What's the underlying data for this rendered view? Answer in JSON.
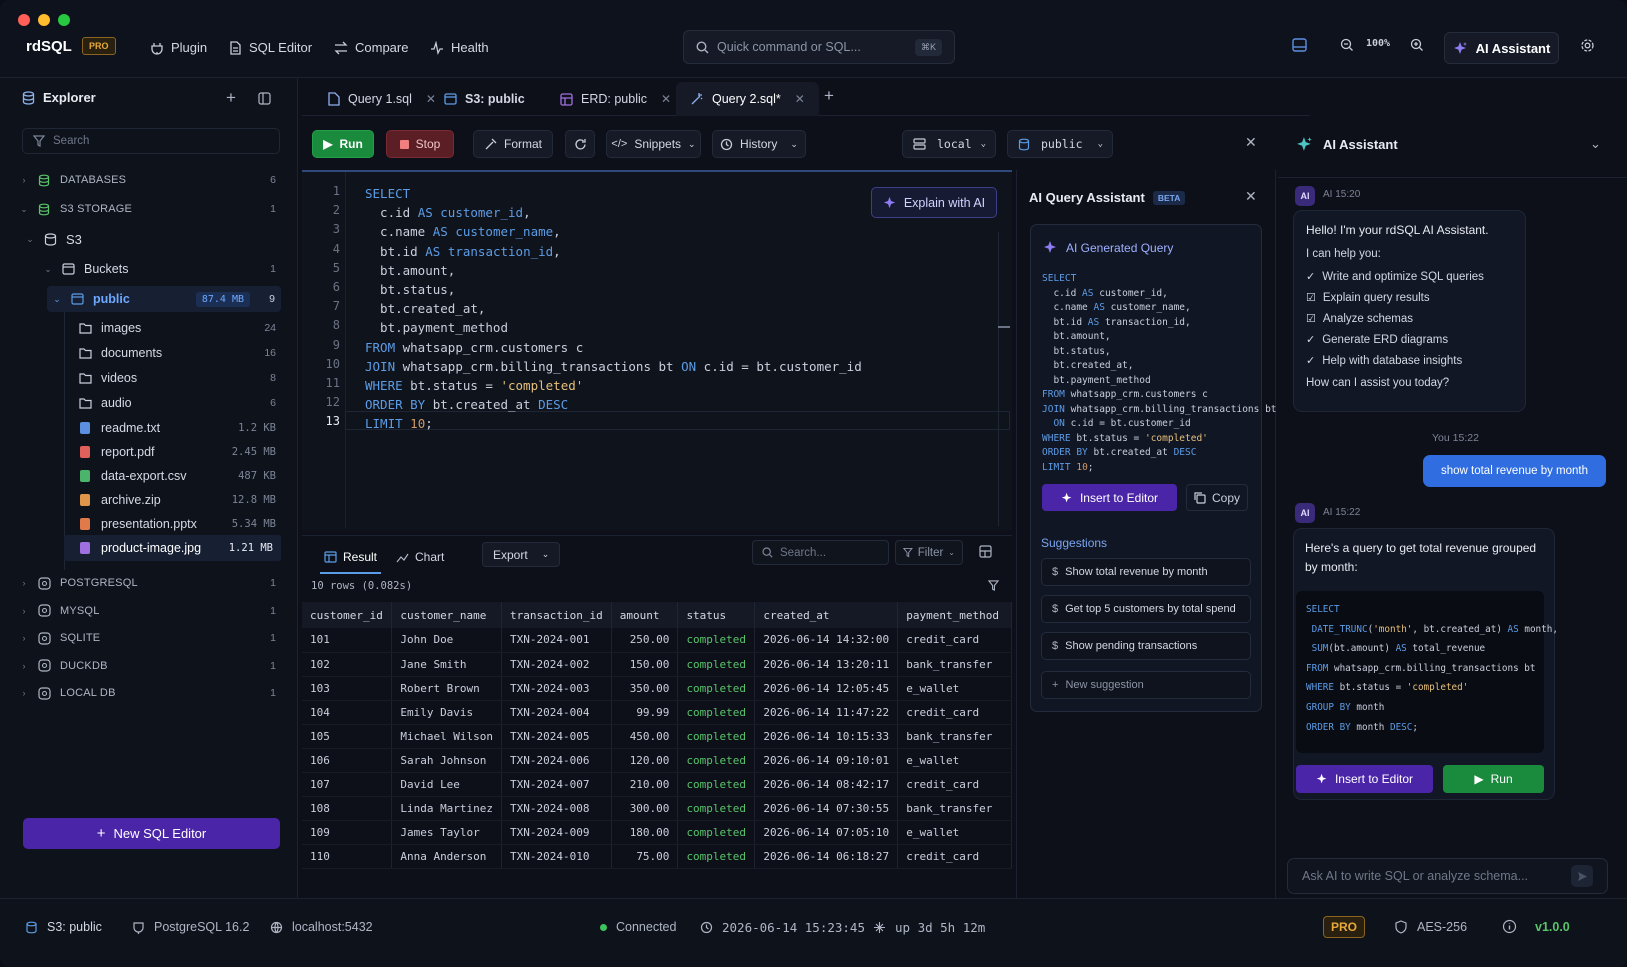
{
  "app": {
    "name": "rdSQL",
    "badge": "PRO"
  },
  "nav": [
    {
      "label": "Plugin",
      "icon": "plugin-icon"
    },
    {
      "label": "SQL Editor",
      "icon": "file-icon"
    },
    {
      "label": "Compare",
      "icon": "compare-icon"
    },
    {
      "label": "Health",
      "icon": "pulse-icon"
    }
  ],
  "quick_search": {
    "placeholder": "Quick command or SQL...",
    "shortcut": "⌘K"
  },
  "zoom": "100%",
  "ai_button": "AI Assistant",
  "explorer": {
    "title": "Explorer",
    "search_placeholder": "Search",
    "databases": {
      "label": "DATABASES",
      "count": "6"
    },
    "s3storage": {
      "label": "S3 STORAGE",
      "count": "1"
    },
    "s3": {
      "label": "S3"
    },
    "buckets": {
      "label": "Buckets",
      "count": "1"
    },
    "public": {
      "label": "public",
      "size": "87.4 MB",
      "count": "9"
    },
    "folders": [
      {
        "label": "images",
        "count": "24"
      },
      {
        "label": "documents",
        "count": "16"
      },
      {
        "label": "videos",
        "count": "8"
      },
      {
        "label": "audio",
        "count": "6"
      }
    ],
    "files": [
      {
        "label": "readme.txt",
        "size": "1.2 KB",
        "color": "#5c8fe0"
      },
      {
        "label": "report.pdf",
        "size": "2.45 MB",
        "color": "#e0605c"
      },
      {
        "label": "data-export.csv",
        "size": "487 KB",
        "color": "#4cb36a"
      },
      {
        "label": "archive.zip",
        "size": "12.8 MB",
        "color": "#e0964a"
      },
      {
        "label": "presentation.pptx",
        "size": "5.34 MB",
        "color": "#e07a4a"
      },
      {
        "label": "product-image.jpg",
        "size": "1.21 MB",
        "color": "#a070e0"
      }
    ],
    "engines": [
      {
        "label": "POSTGRESQL",
        "count": "1"
      },
      {
        "label": "MYSQL",
        "count": "1"
      },
      {
        "label": "SQLITE",
        "count": "1"
      },
      {
        "label": "DUCKDB",
        "count": "1"
      },
      {
        "label": "LOCAL DB",
        "count": "1"
      }
    ],
    "new_editor": "New SQL Editor"
  },
  "tabs": [
    {
      "label": "Query 1.sql"
    },
    {
      "label": "S3: public"
    },
    {
      "label": "ERD: public"
    },
    {
      "label": "Query 2.sql*"
    }
  ],
  "toolbar": {
    "run": "Run",
    "stop": "Stop",
    "format": "Format",
    "snippets": "Snippets",
    "history": "History",
    "conn": "local",
    "schema": "public"
  },
  "editor": {
    "explain": "Explain with AI",
    "line_numbers": [
      "1",
      "2",
      "3",
      "4",
      "5",
      "6",
      "7",
      "8",
      "9",
      "10",
      "11",
      "12",
      "13"
    ]
  },
  "results": {
    "tab_result": "Result",
    "tab_chart": "Chart",
    "export": "Export",
    "search_placeholder": "Search...",
    "filter": "Filter",
    "row_info": "10 rows (0.082s)",
    "columns": [
      "customer_id",
      "customer_name",
      "transaction_id",
      "amount",
      "status",
      "created_at",
      "payment_method"
    ],
    "rows": [
      [
        "101",
        "John Doe",
        "TXN-2024-001",
        "250.00",
        "completed",
        "2026-06-14 14:32:00",
        "credit_card"
      ],
      [
        "102",
        "Jane Smith",
        "TXN-2024-002",
        "150.00",
        "completed",
        "2026-06-14 13:20:11",
        "bank_transfer"
      ],
      [
        "103",
        "Robert Brown",
        "TXN-2024-003",
        "350.00",
        "completed",
        "2026-06-14 12:05:45",
        "e_wallet"
      ],
      [
        "104",
        "Emily Davis",
        "TXN-2024-004",
        "99.99",
        "completed",
        "2026-06-14 11:47:22",
        "credit_card"
      ],
      [
        "105",
        "Michael Wilson",
        "TXN-2024-005",
        "450.00",
        "completed",
        "2026-06-14 10:15:33",
        "bank_transfer"
      ],
      [
        "106",
        "Sarah Johnson",
        "TXN-2024-006",
        "120.00",
        "completed",
        "2026-06-14 09:10:01",
        "e_wallet"
      ],
      [
        "107",
        "David Lee",
        "TXN-2024-007",
        "210.00",
        "completed",
        "2026-06-14 08:42:17",
        "credit_card"
      ],
      [
        "108",
        "Linda Martinez",
        "TXN-2024-008",
        "300.00",
        "completed",
        "2026-06-14 07:30:55",
        "bank_transfer"
      ],
      [
        "109",
        "James Taylor",
        "TXN-2024-009",
        "180.00",
        "completed",
        "2026-06-14 07:05:10",
        "e_wallet"
      ],
      [
        "110",
        "Anna Anderson",
        "TXN-2024-010",
        "75.00",
        "completed",
        "2026-06-14 06:18:27",
        "credit_card"
      ]
    ]
  },
  "ai_query": {
    "title": "AI Query Assistant",
    "beta": "BETA",
    "gen_title": "AI Generated Query",
    "insert": "Insert to Editor",
    "copy": "Copy",
    "suggestions_title": "Suggestions",
    "suggestions": [
      "Show total revenue by month",
      "Get top 5 customers by total spend",
      "Show pending transactions"
    ],
    "new_suggestion": "New suggestion"
  },
  "assistant": {
    "title": "AI Assistant",
    "ai_label": "AI",
    "time1": "AI 15:20",
    "greeting": "Hello! I'm your rdSQL AI Assistant.",
    "help": "I can help you:",
    "items": [
      "Write and optimize SQL queries",
      "Explain query results",
      "Analyze schemas",
      "Generate ERD diagrams",
      "Help with database insights"
    ],
    "ask": "How can I assist you today?",
    "you_time": "You 15:22",
    "user_msg": "show total revenue by month",
    "time2": "AI 15:22",
    "reply": "Here's a query to get total revenue grouped by month:",
    "insert": "Insert to Editor",
    "run": "Run",
    "input_placeholder": "Ask AI to write SQL or analyze schema..."
  },
  "status": {
    "conn": "S3: public",
    "db": "PostgreSQL 16.2",
    "host": "localhost:5432",
    "state": "Connected",
    "time": "2026-06-14 15:23:45",
    "uptime": "up 3d 5h 12m",
    "badge": "PRO",
    "enc": "AES-256",
    "version": "v1.0.0"
  }
}
